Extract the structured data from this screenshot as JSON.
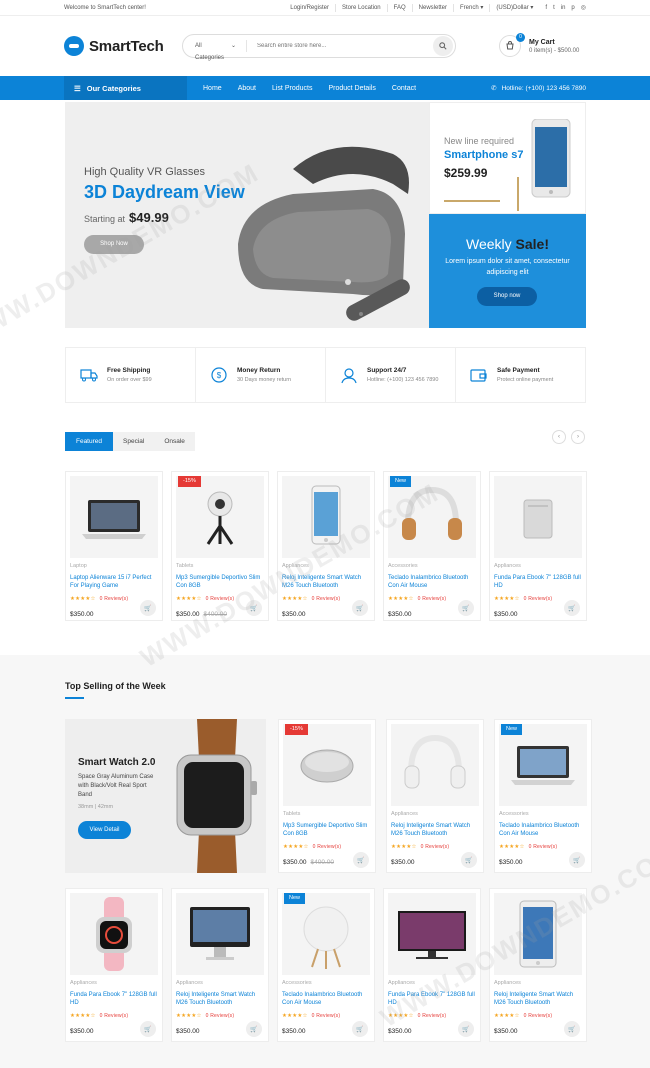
{
  "topbar": {
    "welcome": "Welcome to SmartTech center!",
    "links": [
      "Login/Register",
      "Store Location",
      "FAQ",
      "Newsletter",
      "French ▾",
      "(USD)Dollar ▾"
    ],
    "social": [
      "facebook-icon",
      "twitter-icon",
      "linkedin-icon",
      "pinterest-icon",
      "dribbble-icon"
    ]
  },
  "header": {
    "logo": "SmartTech",
    "search_category": "All Categories",
    "search_placeholder": "Search entire store here...",
    "cart_title": "My Cart",
    "cart_count": "0",
    "cart_summary": "0 item(s) - $500.00"
  },
  "nav": {
    "categories": "Our Categories",
    "items": [
      "Home",
      "About",
      "List Products",
      "Product Details",
      "Contact"
    ],
    "hotline": "Hotline: (+100) 123 456 7890"
  },
  "hero": {
    "subtitle": "High Quality VR Glasses",
    "title": "3D Daydream View",
    "starting": "Starting at",
    "price": "$49.99",
    "button": "Shop Now"
  },
  "side_banner": {
    "line1": "New line required",
    "line2": "Smartphone s7",
    "price": "$259.99"
  },
  "weekly": {
    "title_a": "Weekly",
    "title_b": "Sale!",
    "desc": "Lorem ipsum dolor sit amet, consectetur adipiscing elit",
    "button": "Shop now"
  },
  "services": [
    {
      "icon": "truck-icon",
      "title": "Free Shipping",
      "desc": "On order over $99"
    },
    {
      "icon": "money-return-icon",
      "title": "Money Return",
      "desc": "30 Days money return"
    },
    {
      "icon": "support-icon",
      "title": "Support 24/7",
      "desc": "Hotline: (+100) 123 456 7890"
    },
    {
      "icon": "wallet-icon",
      "title": "Safe Payment",
      "desc": "Protect online payment"
    }
  ],
  "tabs": [
    "Featured",
    "Special",
    "Onsale"
  ],
  "featured": [
    {
      "tag": "",
      "cat": "Laptop",
      "name": "Laptop Alienware 15 i7 Perfect For Playing Game",
      "stars": "★★★★☆",
      "reviews": "0 Review(s)",
      "price": "$350.00",
      "old": ""
    },
    {
      "tag": "-15%",
      "cat": "Tablets",
      "name": "Mp3 Sumergible Deportivo Slim Con 8GB",
      "stars": "★★★★☆",
      "reviews": "0 Review(s)",
      "price": "$350.00",
      "old": "$400.00"
    },
    {
      "tag": "",
      "cat": "Appliances",
      "name": "Reloj Inteligente Smart Watch M26 Touch Bluetooth",
      "stars": "★★★★☆",
      "reviews": "0 Review(s)",
      "price": "$350.00",
      "old": ""
    },
    {
      "tag": "New",
      "cat": "Accessories",
      "name": "Teclado Inalambrico Bluetooth Con Air Mouse",
      "stars": "★★★★☆",
      "reviews": "0 Review(s)",
      "price": "$350.00",
      "old": ""
    },
    {
      "tag": "",
      "cat": "Appliances",
      "name": "Funda Para Ebook 7\" 128GB full HD",
      "stars": "★★★★☆",
      "reviews": "0 Review(s)",
      "price": "$350.00",
      "old": ""
    }
  ],
  "top_selling": {
    "title": "Top Selling of the Week",
    "promo": {
      "title": "Smart Watch 2.0",
      "desc": "Space Gray Aluminum Case with Black/Volt Real Sport Band",
      "meta": "38mm | 42mm",
      "button": "View Detail"
    },
    "row1": [
      {
        "tag": "-15%",
        "cat": "Tablets",
        "name": "Mp3 Sumergible Deportivo Slim Con 8GB",
        "stars": "★★★★☆",
        "reviews": "0 Review(s)",
        "price": "$350.00",
        "old": "$400.00"
      },
      {
        "tag": "",
        "cat": "Appliances",
        "name": "Reloj Inteligente Smart Watch M26 Touch Bluetooth",
        "stars": "★★★★☆",
        "reviews": "0 Review(s)",
        "price": "$350.00",
        "old": ""
      },
      {
        "tag": "New",
        "cat": "Accessories",
        "name": "Teclado Inalambrico Bluetooth Con Air Mouse",
        "stars": "★★★★☆",
        "reviews": "0 Review(s)",
        "price": "$350.00",
        "old": ""
      }
    ],
    "row2": [
      {
        "tag": "",
        "cat": "Appliances",
        "name": "Funda Para Ebook 7\" 128GB full HD",
        "stars": "★★★★☆",
        "reviews": "0 Review(s)",
        "price": "$350.00",
        "old": ""
      },
      {
        "tag": "",
        "cat": "Appliances",
        "name": "Reloj Inteligente Smart Watch M26 Touch Bluetooth",
        "stars": "★★★★☆",
        "reviews": "0 Review(s)",
        "price": "$350.00",
        "old": ""
      },
      {
        "tag": "New",
        "cat": "Accessories",
        "name": "Teclado Inalambrico Bluetooth Con Air Mouse",
        "stars": "★★★★☆",
        "reviews": "0 Review(s)",
        "price": "$350.00",
        "old": ""
      },
      {
        "tag": "",
        "cat": "Appliances",
        "name": "Funda Para Ebook 7\" 128GB full HD",
        "stars": "★★★★☆",
        "reviews": "0 Review(s)",
        "price": "$350.00",
        "old": ""
      },
      {
        "tag": "",
        "cat": "Appliances",
        "name": "Reloj Inteligente Smart Watch M26 Touch Bluetooth",
        "stars": "★★★★☆",
        "reviews": "0 Review(s)",
        "price": "$350.00",
        "old": ""
      }
    ]
  },
  "watermark": "WWW.DOWNDEMO.COM",
  "colors": {
    "accent": "#0c83d7",
    "sale": "#e53935",
    "star": "#f5a623"
  }
}
